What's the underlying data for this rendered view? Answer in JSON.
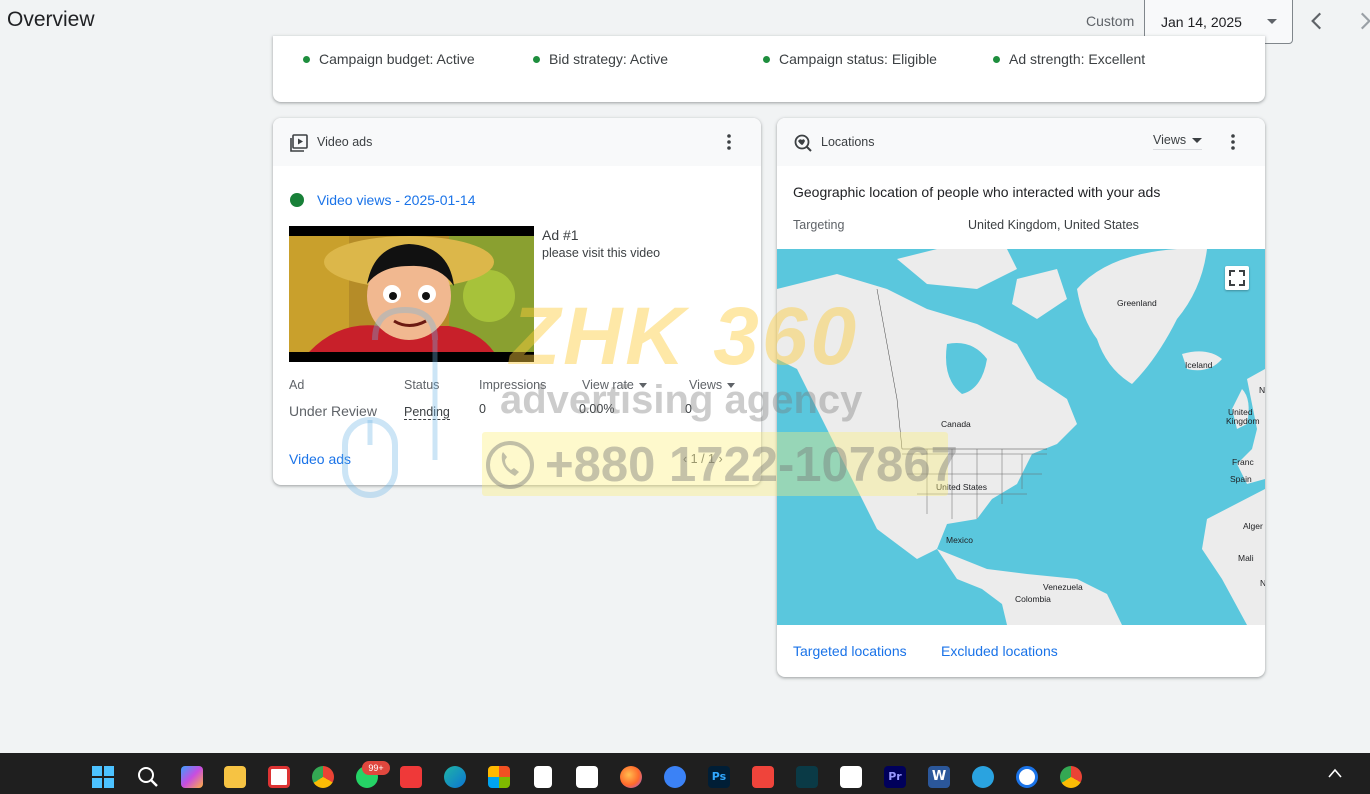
{
  "header": {
    "title": "Overview",
    "range_label": "Custom",
    "date_value": "Jan 14, 2025"
  },
  "status_bar": {
    "items": [
      "Campaign budget: Active",
      "Bid strategy: Active",
      "Campaign status: Eligible",
      "Ad strength: Excellent"
    ]
  },
  "video_card": {
    "title": "Video ads",
    "campaign_link": "Video views - 2025-01-14",
    "ad_name": "Ad #1",
    "ad_description": "please visit this video",
    "columns": [
      "Ad",
      "Status",
      "Impressions",
      "View rate",
      "Views"
    ],
    "row": {
      "ad": "Under Review",
      "status": "Pending",
      "impressions": "0",
      "view_rate": "0.00%",
      "views": "0"
    },
    "footer_link": "Video ads",
    "pagination": "1 / 1"
  },
  "locations_card": {
    "title": "Locations",
    "metric_dropdown": "Views",
    "heading": "Geographic location of people who interacted with your ads",
    "targeting_label": "Targeting",
    "targeting_value": "United Kingdom, United States",
    "map_labels": {
      "greenland": "Greenland",
      "iceland": "Iceland",
      "canada": "Canada",
      "united_states": "United States",
      "mexico": "Mexico",
      "venezuela": "Venezuela",
      "colombia": "Colombia",
      "uk_1": "United",
      "uk_2": "Kingdom",
      "france": "Franc",
      "spain": "Spain",
      "algeria": "Alger",
      "mali": "Mali",
      "edge_n1": "N",
      "edge_n2": "N"
    },
    "links": [
      "Targeted locations",
      "Excluded locations"
    ]
  },
  "watermark": {
    "logo": "ZHK 360",
    "tagline": "advertising agency",
    "phone": "+880 1722-107867"
  },
  "taskbar": {
    "whatsapp_badge": "99+",
    "icons": [
      "windows-start-icon",
      "search-icon",
      "copilot-icon",
      "file-explorer-icon",
      "snipping-tool-icon",
      "chrome-icon",
      "whatsapp-icon",
      "vivaldi-icon",
      "edge-icon",
      "microsoft-store-icon",
      "notepad-icon",
      "capcut-icon",
      "firefox-icon",
      "sync-icon",
      "photoshop-icon",
      "anydesk-icon",
      "filmora-icon",
      "capcut-icon-2",
      "premiere-pro-icon",
      "word-icon",
      "telegram-icon",
      "app-store-icon",
      "chrome-profile-icon"
    ],
    "photoshop_text": "Ps",
    "premiere_text": "Pr",
    "word_text": "W"
  },
  "colors": {
    "accent_blue": "#1a73e8",
    "status_green": "#1e8e3e",
    "map_water": "#5ac7dd",
    "map_land": "#ececec"
  }
}
